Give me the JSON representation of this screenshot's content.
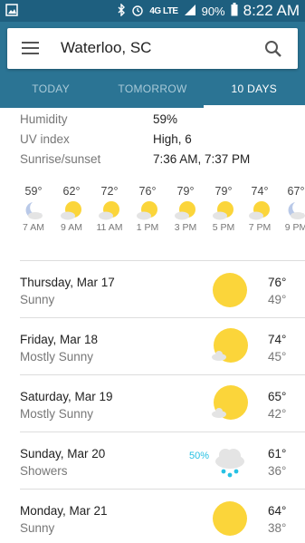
{
  "status_bar": {
    "network": "4G LTE",
    "battery": "90%",
    "time": "8:22 AM"
  },
  "search": {
    "location": "Waterloo, SC"
  },
  "tabs": [
    {
      "label": "TODAY"
    },
    {
      "label": "TOMORROW"
    },
    {
      "label": "10 DAYS"
    }
  ],
  "details": [
    {
      "label": "Humidity",
      "value": "59%"
    },
    {
      "label": "UV index",
      "value": "High, 6"
    },
    {
      "label": "Sunrise/sunset",
      "value": "7:36 AM, 7:37 PM"
    }
  ],
  "hourly": [
    {
      "temp": "59°",
      "time": "7 AM",
      "icon": "moon-icon"
    },
    {
      "temp": "62°",
      "time": "9 AM",
      "icon": "partly-sunny-icon"
    },
    {
      "temp": "72°",
      "time": "11 AM",
      "icon": "partly-sunny-icon"
    },
    {
      "temp": "76°",
      "time": "1 PM",
      "icon": "partly-sunny-icon"
    },
    {
      "temp": "79°",
      "time": "3 PM",
      "icon": "partly-sunny-icon"
    },
    {
      "temp": "79°",
      "time": "5 PM",
      "icon": "partly-sunny-icon"
    },
    {
      "temp": "74°",
      "time": "7 PM",
      "icon": "partly-sunny-icon"
    },
    {
      "temp": "67°",
      "time": "9 PM",
      "icon": "moon-cloud-icon"
    }
  ],
  "daily": [
    {
      "date": "Thursday, Mar 17",
      "condition": "Sunny",
      "high": "76°",
      "low": "49°",
      "icon": "sun-icon",
      "precip": ""
    },
    {
      "date": "Friday, Mar 18",
      "condition": "Mostly Sunny",
      "high": "74°",
      "low": "45°",
      "icon": "mostly-sunny-icon",
      "precip": ""
    },
    {
      "date": "Saturday, Mar 19",
      "condition": "Mostly Sunny",
      "high": "65°",
      "low": "42°",
      "icon": "mostly-sunny-icon",
      "precip": ""
    },
    {
      "date": "Sunday, Mar 20",
      "condition": "Showers",
      "high": "61°",
      "low": "36°",
      "icon": "showers-icon",
      "precip": "50%"
    },
    {
      "date": "Monday, Mar 21",
      "condition": "Sunny",
      "high": "64°",
      "low": "38°",
      "icon": "sun-icon",
      "precip": ""
    }
  ],
  "colors": {
    "status_bar": "#1e5f7f",
    "app_bar": "#2b7494",
    "sun": "#fbd53a",
    "precip": "#27c1e3"
  }
}
